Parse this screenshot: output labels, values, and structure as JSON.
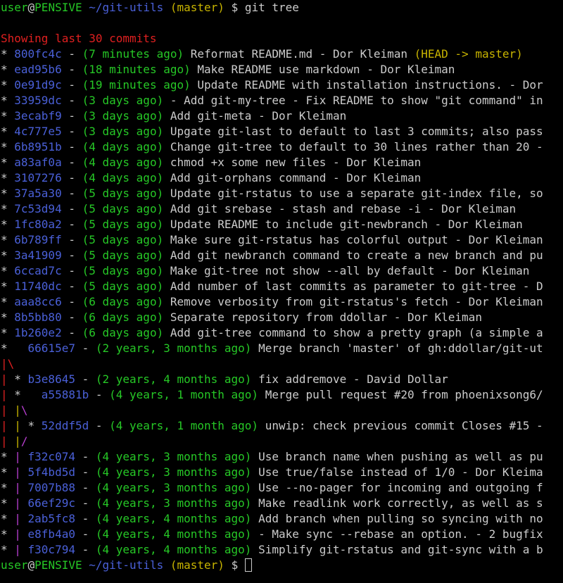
{
  "terminal": {
    "prompt1": {
      "user": "user",
      "at": "@",
      "host": "PENSIVE",
      "path": "~/git-utils",
      "branch": "(master)",
      "symbol": "$",
      "command": "git tree"
    },
    "header": "Showing last 30 commits",
    "rows": [
      {
        "g": "* ",
        "hash": "800fc4c",
        "sep": " - ",
        "date": "(7 minutes ago)",
        "msg": " Reformat README.md - Dor Kleiman ",
        "ref": "(HEAD -> master)"
      },
      {
        "g": "* ",
        "hash": "ead95b6",
        "sep": " - ",
        "date": "(18 minutes ago)",
        "msg": " Make README use markdown - Dor Kleiman",
        "ref": ""
      },
      {
        "g": "* ",
        "hash": "0e91d9c",
        "sep": " - ",
        "date": "(19 minutes ago)",
        "msg": " Update README with installation instructions. - Dor",
        "ref": ""
      },
      {
        "g": "* ",
        "hash": "33959dc",
        "sep": " - ",
        "date": "(3 days ago)",
        "msg": " - Add git-my-tree - Fix README to show \"git command\" in",
        "ref": ""
      },
      {
        "g": "* ",
        "hash": "3ecabf9",
        "sep": " - ",
        "date": "(3 days ago)",
        "msg": " Add git-meta - Dor Kleiman",
        "ref": ""
      },
      {
        "g": "* ",
        "hash": "4c777e5",
        "sep": " - ",
        "date": "(3 days ago)",
        "msg": " Upgate git-last to default to last 3 commits; also pass",
        "ref": ""
      },
      {
        "g": "* ",
        "hash": "6b8951b",
        "sep": " - ",
        "date": "(4 days ago)",
        "msg": " Change git-tree to default to 30 lines rather than 20 -",
        "ref": ""
      },
      {
        "g": "* ",
        "hash": "a83af0a",
        "sep": " - ",
        "date": "(4 days ago)",
        "msg": " chmod +x some new files - Dor Kleiman",
        "ref": ""
      },
      {
        "g": "* ",
        "hash": "3107276",
        "sep": " - ",
        "date": "(4 days ago)",
        "msg": " Add git-orphans command - Dor Kleiman",
        "ref": ""
      },
      {
        "g": "* ",
        "hash": "37a5a30",
        "sep": " - ",
        "date": "(5 days ago)",
        "msg": " Update git-rstatus to use a separate git-index file, so",
        "ref": ""
      },
      {
        "g": "* ",
        "hash": "7c53d94",
        "sep": " - ",
        "date": "(5 days ago)",
        "msg": " Add git srebase - stash and rebase -i - Dor Kleiman",
        "ref": ""
      },
      {
        "g": "* ",
        "hash": "1fc80a2",
        "sep": " - ",
        "date": "(5 days ago)",
        "msg": " Update README to include git-newbranch - Dor Kleiman",
        "ref": ""
      },
      {
        "g": "* ",
        "hash": "6b789ff",
        "sep": " - ",
        "date": "(5 days ago)",
        "msg": " Make sure git-rstatus has colorful output - Dor Kleiman",
        "ref": ""
      },
      {
        "g": "* ",
        "hash": "3a41909",
        "sep": " - ",
        "date": "(5 days ago)",
        "msg": " Add git newbranch command to create a new branch and pu",
        "ref": ""
      },
      {
        "g": "* ",
        "hash": "6ccad7c",
        "sep": " - ",
        "date": "(5 days ago)",
        "msg": " Make git-tree not show --all by default - Dor Kleiman",
        "ref": ""
      },
      {
        "g": "* ",
        "hash": "11740dc",
        "sep": " - ",
        "date": "(5 days ago)",
        "msg": " Add number of last commits as parameter to git-tree - D",
        "ref": ""
      },
      {
        "g": "* ",
        "hash": "aaa8cc6",
        "sep": " - ",
        "date": "(6 days ago)",
        "msg": " Remove verbosity from git-rstatus's fetch - Dor Kleiman",
        "ref": ""
      },
      {
        "g": "* ",
        "hash": "8b5bb80",
        "sep": " - ",
        "date": "(6 days ago)",
        "msg": " Separate repository from ddollar - Dor Kleiman",
        "ref": ""
      },
      {
        "g": "* ",
        "hash": "1b260e2",
        "sep": " - ",
        "date": "(6 days ago)",
        "msg": " Add git-tree command to show a pretty graph (a simple a",
        "ref": ""
      }
    ],
    "merge_row": {
      "g": "*   ",
      "hash": "66615e7",
      "sep": " - ",
      "date": "(2 years, 3 months ago)",
      "msg": " Merge branch 'master' of gh:ddollar/git-ut"
    },
    "graph_line_1": "|\\",
    "row_b3e": {
      "g1": "| ",
      "g2": "* ",
      "hash": "b3e8645",
      "sep": " - ",
      "date": "(2 years, 4 months ago)",
      "msg": " fix addremove - David Dollar"
    },
    "row_a55": {
      "g1": "| ",
      "g2": "*   ",
      "hash": "a55881b",
      "sep": " - ",
      "date": "(4 years, 1 month ago)",
      "msg": " Merge pull request #20 from phoenixsong6/"
    },
    "graph_line_2": {
      "a": "| ",
      "b": "|",
      "c": "\\"
    },
    "row_52d": {
      "g1": "| ",
      "g2": "| ",
      "g3": "* ",
      "hash": "52ddf5d",
      "sep": " - ",
      "date": "(4 years, 1 month ago)",
      "msg": " unwip: check previous commit Closes #15 -"
    },
    "graph_line_3": {
      "a": "| ",
      "b": "|",
      "c": "/"
    },
    "tail_rows": [
      {
        "g1": "* ",
        "g2": "| ",
        "hash": "f32c074",
        "sep": " - ",
        "date": "(4 years, 3 months ago)",
        "msg": " Use branch name when pushing as well as pu"
      },
      {
        "g1": "* ",
        "g2": "| ",
        "hash": "5f4bd5d",
        "sep": " - ",
        "date": "(4 years, 3 months ago)",
        "msg": " Use true/false instead of 1/0 - Dor Kleima"
      },
      {
        "g1": "* ",
        "g2": "| ",
        "hash": "7007b88",
        "sep": " - ",
        "date": "(4 years, 3 months ago)",
        "msg": " Use --no-pager for incoming and outgoing f"
      },
      {
        "g1": "* ",
        "g2": "| ",
        "hash": "66ef29c",
        "sep": " - ",
        "date": "(4 years, 3 months ago)",
        "msg": " Make readlink work correctly, as well as s"
      },
      {
        "g1": "* ",
        "g2": "| ",
        "hash": "2ab5fc8",
        "sep": " - ",
        "date": "(4 years, 4 months ago)",
        "msg": " Add branch when pulling so syncing with no"
      },
      {
        "g1": "* ",
        "g2": "| ",
        "hash": "e8fb4a0",
        "sep": " - ",
        "date": "(4 years, 4 months ago)",
        "msg": " - Make sync --rebase an option. - 2 bugfix"
      },
      {
        "g1": "* ",
        "g2": "| ",
        "hash": "f30c794",
        "sep": " - ",
        "date": "(4 years, 4 months ago)",
        "msg": " Simplify git-rstatus and git-sync with a b"
      }
    ],
    "prompt2": {
      "user": "user",
      "at": "@",
      "host": "PENSIVE",
      "path": "~/git-utils",
      "branch": "(master)",
      "symbol": "$"
    },
    "colors": {
      "background": "#000000",
      "text": "#cccccc",
      "green": "#26c826",
      "blue": "#4a60d8",
      "yellow": "#c8b400",
      "red": "#e02020",
      "magenta": "#b83fd1"
    }
  }
}
